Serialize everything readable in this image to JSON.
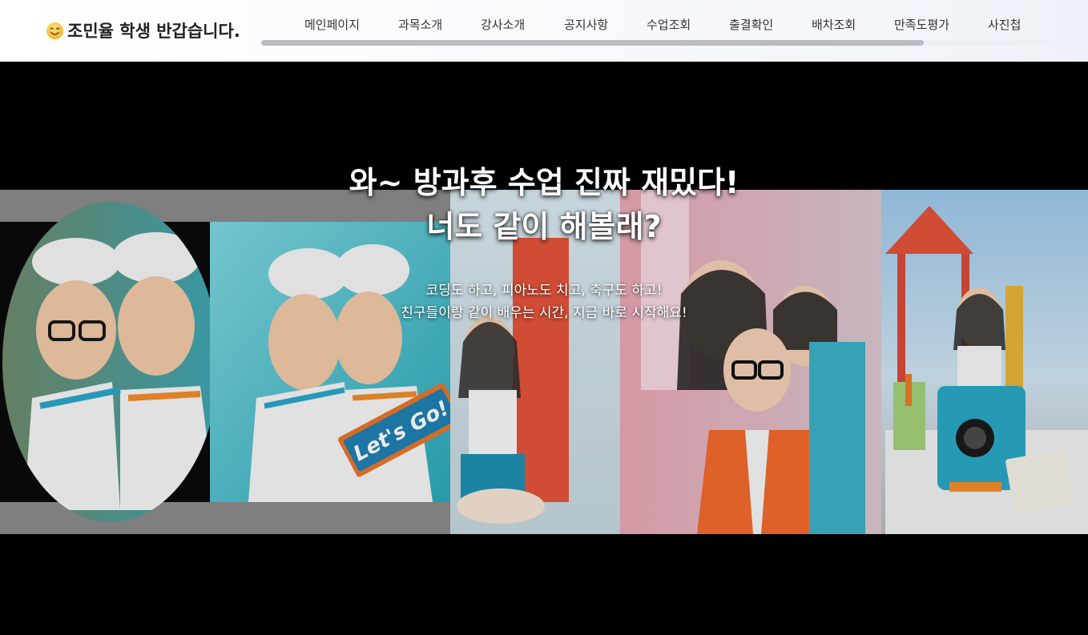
{
  "header": {
    "greeting": "조민율 학생 반갑습니다.",
    "greeting_icon": "smiling-face-icon",
    "nav_items": [
      "메인페이지",
      "과목소개",
      "강사소개",
      "공지사항",
      "수업조회",
      "출결확인",
      "배차조회",
      "만족도평가",
      "사진첩"
    ],
    "nav_scroll_fraction": 0.84
  },
  "hero": {
    "title_line1": "와~ 방과후 수업 진짜 재밌다!",
    "title_line2": "너도 같이 해볼래?",
    "subtitle_line1": "코딩도 하고, 피아노도 치고, 축구도 하고!",
    "subtitle_line2": "친구들이랑 같이 배우는 시간, 지금 바로 시작해요!",
    "banner_text": "Let's Go!"
  },
  "colors": {
    "header_bg": "#f5f7fa",
    "hero_bg": "#000000",
    "nav_scroll_thumb": "#b9bcc0"
  }
}
